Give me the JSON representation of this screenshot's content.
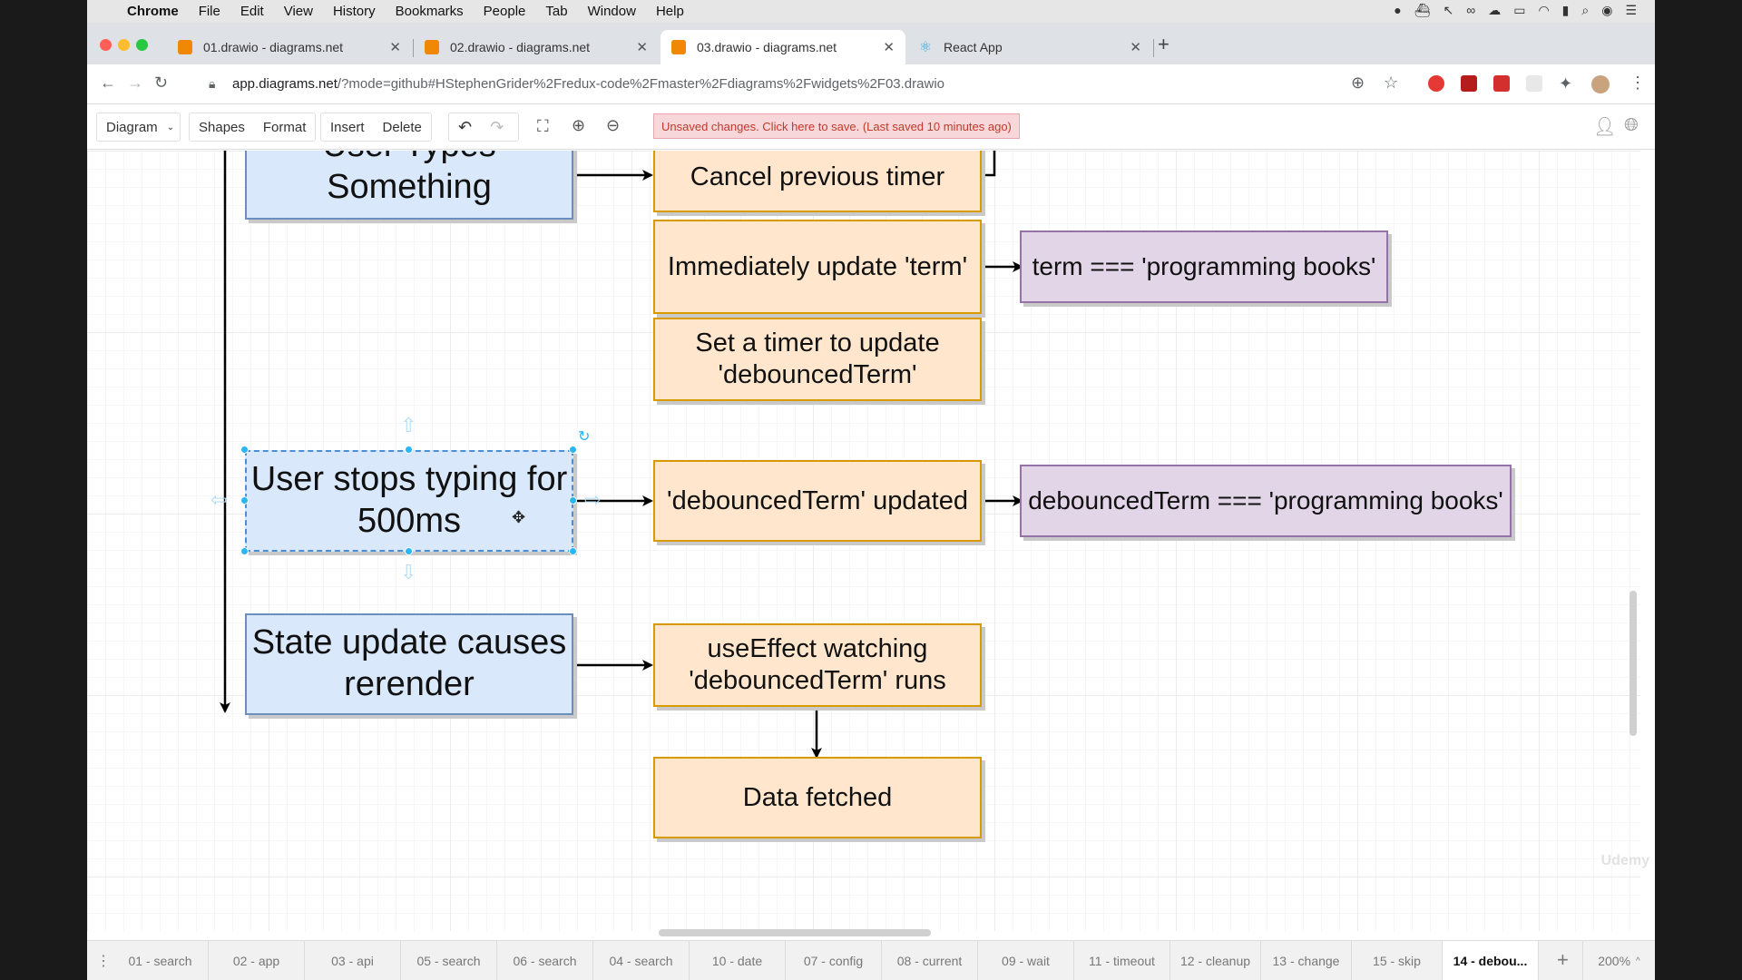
{
  "menubar": {
    "app": "Chrome",
    "items": [
      "File",
      "Edit",
      "View",
      "History",
      "Bookmarks",
      "People",
      "Tab",
      "Window",
      "Help"
    ]
  },
  "tabs": [
    {
      "title": "01.drawio - diagrams.net"
    },
    {
      "title": "02.drawio - diagrams.net"
    },
    {
      "title": "03.drawio - diagrams.net"
    },
    {
      "title": "React App"
    }
  ],
  "address": {
    "host": "app.diagrams.net",
    "path": "/?mode=github#HStephenGrider%2Fredux-code%2Fmaster%2Fdiagrams%2Fwidgets%2F03.drawio"
  },
  "toolbar": {
    "diagram": "Diagram",
    "shapes": "Shapes",
    "format": "Format",
    "insert": "Insert",
    "delete": "Delete",
    "unsaved": "Unsaved changes. Click here to save. (Last saved 10 minutes ago)"
  },
  "diagram": {
    "user_types": "User Types Something",
    "user_stops": "User stops typing for 500ms",
    "state_update": "State update causes rerender",
    "cancel_timer": "Cancel previous timer",
    "update_term": "Immediately update 'term'",
    "set_timer": "Set a timer to update 'debouncedTerm'",
    "debounced_updated": "'debouncedTerm' updated",
    "use_effect": "useEffect watching 'debouncedTerm' runs",
    "data_fetched": "Data fetched",
    "term_value": "term === 'programming books'",
    "debounced_value": "debouncedTerm === 'programming books'"
  },
  "pages": [
    "01 - search",
    "02 - app",
    "03 - api",
    "05 - search",
    "06 - search",
    "04 - search",
    "10 - date",
    "07 - config",
    "08 - current",
    "09 - wait",
    "11 - timeout",
    "12 - cleanup",
    "13 - change",
    "15 - skip",
    "14 - debou..."
  ],
  "zoom": "200%",
  "watermark": "Udemy"
}
